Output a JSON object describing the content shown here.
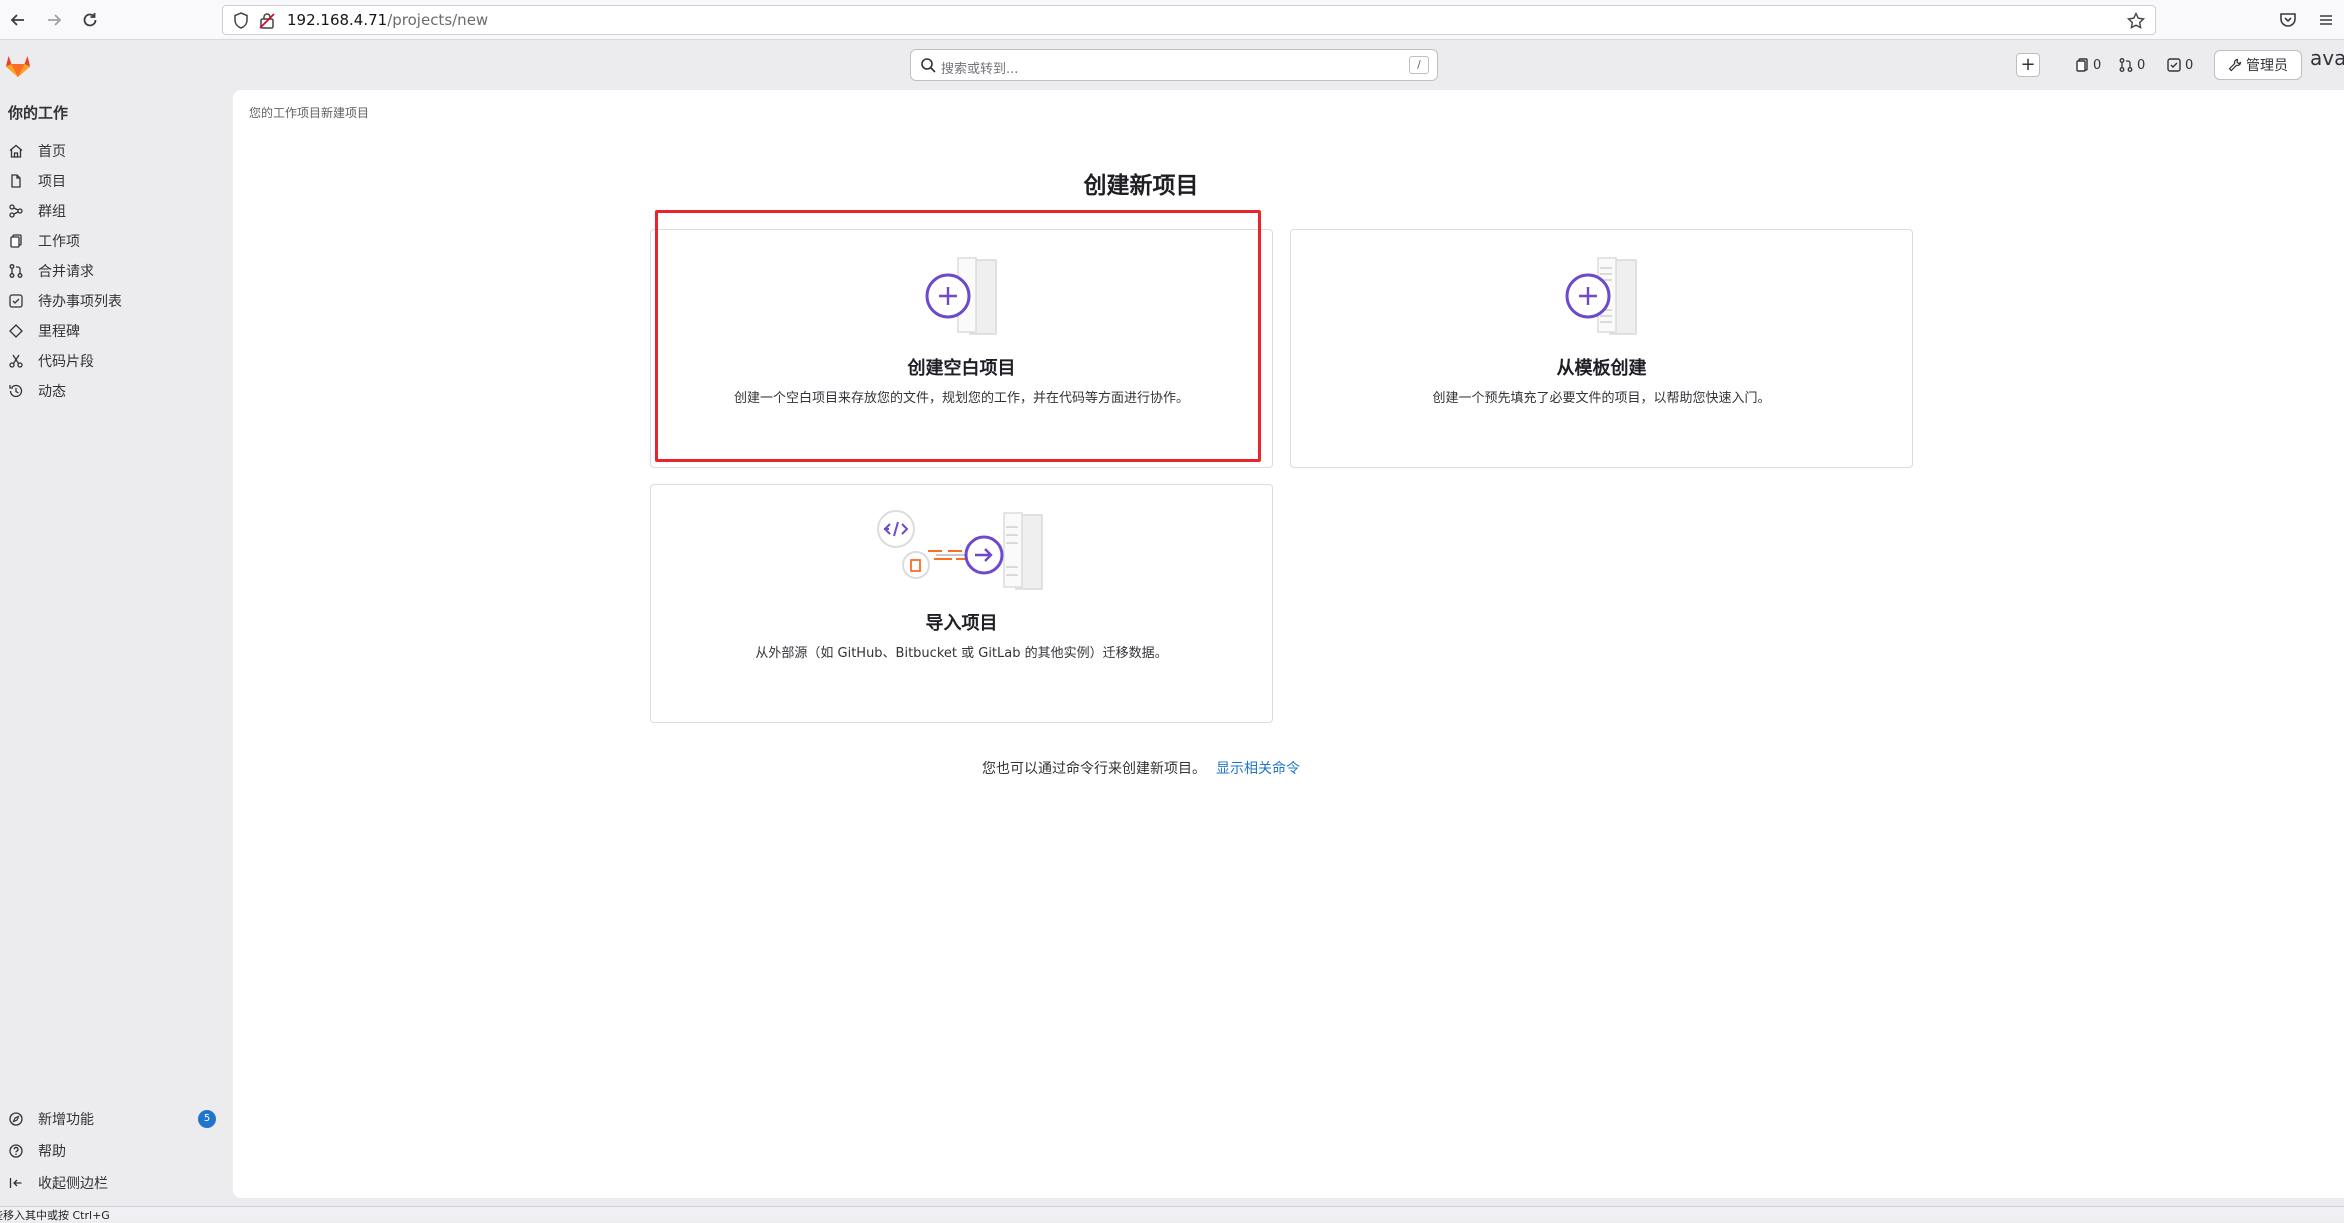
{
  "browser": {
    "url_host": "192.168.4.71",
    "url_path": "/projects/new"
  },
  "topbar": {
    "search_placeholder": "搜索或转到...",
    "search_shortcut": "/",
    "issues_count": "0",
    "mr_count": "0",
    "todo_count": "0",
    "admin_label": "管理员",
    "user_name": "ava"
  },
  "sidebar": {
    "title": "你的工作",
    "items": [
      {
        "label": "首页",
        "icon": "home-icon"
      },
      {
        "label": "项目",
        "icon": "project-icon"
      },
      {
        "label": "群组",
        "icon": "group-icon"
      },
      {
        "label": "工作项",
        "icon": "work-items-icon"
      },
      {
        "label": "合并请求",
        "icon": "merge-request-icon"
      },
      {
        "label": "待办事项列表",
        "icon": "todo-icon"
      },
      {
        "label": "里程碑",
        "icon": "milestone-icon"
      },
      {
        "label": "代码片段",
        "icon": "snippet-icon"
      },
      {
        "label": "动态",
        "icon": "activity-icon"
      }
    ],
    "bottom": {
      "whats_new": "新增功能",
      "whats_new_badge": "5",
      "help": "帮助",
      "collapse": "收起侧边栏"
    }
  },
  "main": {
    "breadcrumb": "您的工作项目新建项目",
    "title": "创建新项目",
    "cards": {
      "blank": {
        "title": "创建空白项目",
        "desc": "创建一个空白项目来存放您的文件，规划您的工作，并在代码等方面进行协作。"
      },
      "template": {
        "title": "从模板创建",
        "desc": "创建一个预先填充了必要文件的项目，以帮助您快速入门。"
      },
      "import": {
        "title": "导入项目",
        "desc": "从外部源（如 GitHub、Bitbucket 或 GitLab 的其他实例）迁移数据。"
      }
    },
    "cli_note": "您也可以通过命令行来创建新项目。",
    "cli_link": "显示相关命令"
  },
  "statusbar": {
    "text": "些移入其中或按 Ctrl+G"
  },
  "colors": {
    "accent": "#1f75cb",
    "illustration_purple": "#6e49cb",
    "highlight_red": "#e8242c",
    "gitlab_orange": "#fc6d26"
  }
}
